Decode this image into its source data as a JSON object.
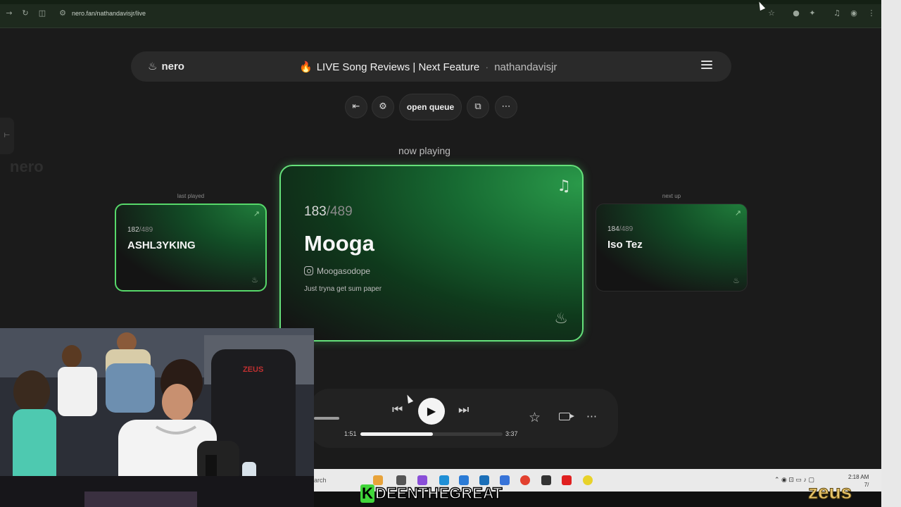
{
  "browser": {
    "url": "nero.fan/nathandavisjr/live"
  },
  "header": {
    "brand": "nero",
    "live_title": "LIVE Song Reviews | Next Feature",
    "separator": "·",
    "username": "nathandavisjr"
  },
  "toolbar": {
    "open_queue_label": "open queue"
  },
  "ghost_logo": "nero",
  "now_playing_label": "now playing",
  "last_played": {
    "label": "last played",
    "position": "182",
    "total": "/489",
    "artist": "ASHL3YKING"
  },
  "current": {
    "position": "183",
    "total": "/489",
    "artist": "Mooga",
    "instagram": "Moogasodope",
    "tagline": "Just tryna get sum paper"
  },
  "next_up": {
    "label": "next up",
    "position": "184",
    "total": "/489",
    "artist": "Iso Tez"
  },
  "player": {
    "elapsed": "1:51",
    "duration": "3:37",
    "progress": 0.51
  },
  "taskbar": {
    "search_placeholder": "arch",
    "time": "2:18 AM",
    "date": "7/"
  },
  "overlay": {
    "streamer_initial": "K",
    "streamer_name": "DEENTHEGREAT",
    "watermark": "zeus"
  },
  "colors": {
    "accent_green": "#57d86a",
    "fire": "#ff7a1a"
  }
}
